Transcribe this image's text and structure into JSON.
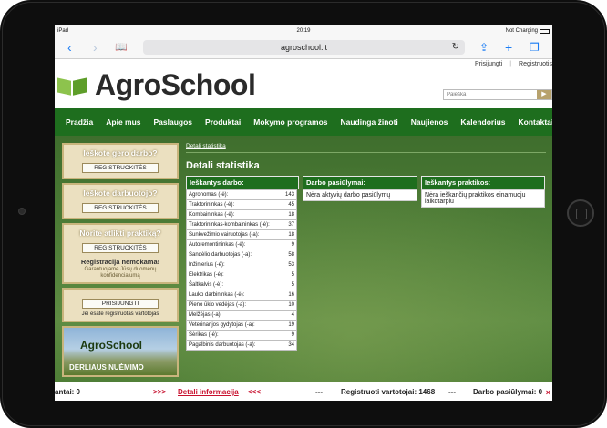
{
  "status_bar": {
    "device": "iPad",
    "time": "20:19",
    "charging": "Not Charging"
  },
  "browser": {
    "url": "agroschool.lt",
    "back_icon": "chevron-left-icon",
    "forward_icon": "chevron-right-icon",
    "bookmarks_icon": "book-icon",
    "share_icon": "share-icon",
    "new_tab_icon": "plus-icon",
    "tabs_icon": "tabs-icon",
    "reload_icon": "reload-icon"
  },
  "header": {
    "links": [
      "Prisijungti",
      "Registruotis"
    ],
    "logo_text": "AgroSchool",
    "search_placeholder": "Paieška"
  },
  "nav": [
    "Pradžia",
    "Apie mus",
    "Paslaugos",
    "Produktai",
    "Mokymo programos",
    "Naudinga žinoti",
    "Naujienos",
    "Kalendorius",
    "Kontaktai"
  ],
  "sidebar": {
    "box1": {
      "title": "Ieškote gero darbo?",
      "button": "REGISTRUOKITĖS"
    },
    "box2": {
      "title": "Ieškote darbuotojo?",
      "button": "REGISTRUOKITĖS"
    },
    "box3": {
      "title": "Norite atlikti praktiką?",
      "button": "REGISTRUOKITĖS",
      "note": "Registracija nemokama!",
      "sub1": "Garantuojame Jūsų duomenų",
      "sub2": "konfidencialumą"
    },
    "login": {
      "button": "PRISIJUNGTI",
      "caption": "Jei esate registruotas vartotojas"
    },
    "banner": {
      "logo": "AgroSchool",
      "text": "DERLIAUS NUĖMIMO"
    }
  },
  "main": {
    "breadcrumb": "Detali statistika",
    "title": "Detali statistika",
    "panel1": {
      "title": "Ieškantys darbo:",
      "rows": [
        {
          "label": "Agronomas (-ė):",
          "count": "143"
        },
        {
          "label": "Traktorininkas (-ė):",
          "count": "45"
        },
        {
          "label": "Kombaininkas (-ė):",
          "count": "18"
        },
        {
          "label": "Traktorininkas-kombaininkas (-ė):",
          "count": "37"
        },
        {
          "label": "Sunkvežimio vairuotojas (-a):",
          "count": "18"
        },
        {
          "label": "Autoremontininkas (-ė):",
          "count": "9"
        },
        {
          "label": "Sandėlio darbuotojas (-a):",
          "count": "58"
        },
        {
          "label": "Inžinierius (-ė):",
          "count": "53"
        },
        {
          "label": "Elektrikas (-ė):",
          "count": "5"
        },
        {
          "label": "Šaltkalvis (-ė):",
          "count": "5"
        },
        {
          "label": "Lauko darbininkas (-ė):",
          "count": "16"
        },
        {
          "label": "Pieno ūkio vedėjas (-a):",
          "count": "10"
        },
        {
          "label": "Melžėjas (-a):",
          "count": "4"
        },
        {
          "label": "Veterinarijos gydytojas (-a):",
          "count": "19"
        },
        {
          "label": "Šėrikas (-ė):",
          "count": "9"
        },
        {
          "label": "Pagalbinis darbuotojas (-a):",
          "count": "34"
        }
      ]
    },
    "panel2": {
      "title": "Darbo pasiūlymai:",
      "body": "Nėra aktyvių darbo pasiūlymų"
    },
    "panel3": {
      "title": "Ieškantys praktikos:",
      "body": "Nėra ieškančių praktikos einamuoju laikotarpiu"
    }
  },
  "bottom_bar": {
    "left": "antai: 0",
    "arrows_right": ">>>",
    "link": "Detali informacija",
    "arrows_left": "<<<",
    "dashes": "---",
    "registered": "Registruoti vartotojai: 1468",
    "dashes2": "---",
    "offers": "Darbo pasiūlymai: 0",
    "close": "×"
  }
}
